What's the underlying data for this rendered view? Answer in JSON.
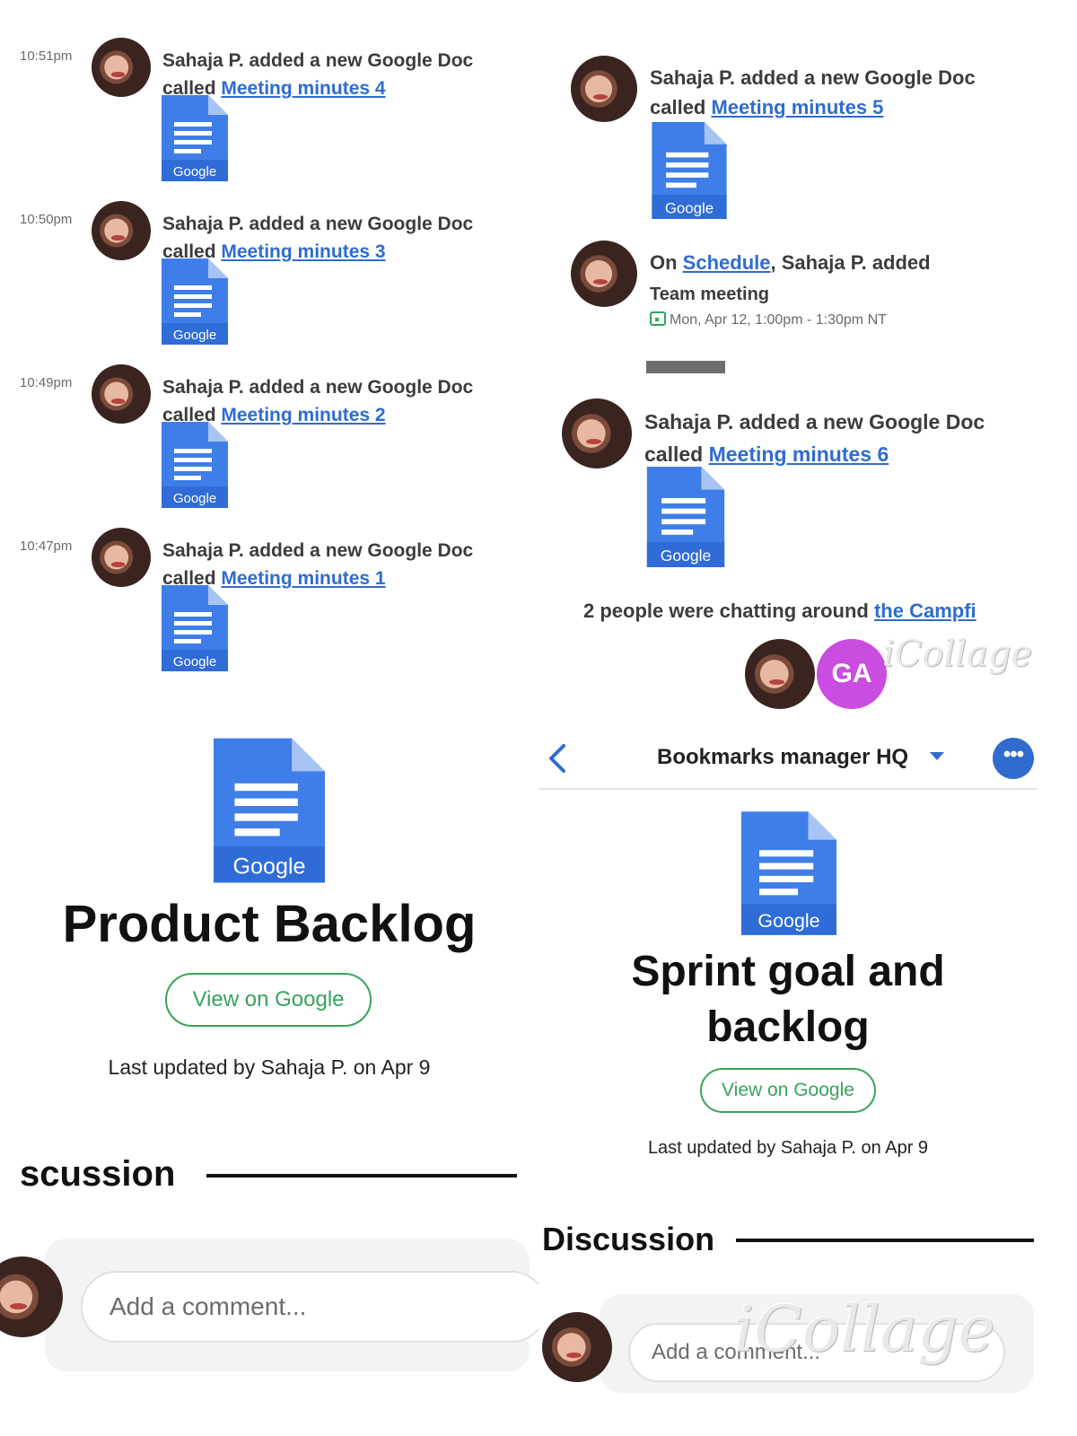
{
  "feed": [
    {
      "time": "10:51pm",
      "prefix": "Sahaja P. added a new Google Doc",
      "called": "called ",
      "link": "Meeting minutes 4",
      "icon_label": "Google"
    },
    {
      "time": "10:50pm",
      "prefix": "Sahaja P. added a new Google Doc",
      "called": "called ",
      "link": "Meeting minutes 3",
      "icon_label": "Google"
    },
    {
      "time": "10:49pm",
      "prefix": "Sahaja P. added a new Google Doc",
      "called": "called ",
      "link": "Meeting minutes 2",
      "icon_label": "Google"
    },
    {
      "time": "10:47pm",
      "prefix": "Sahaja P. added a new Google Doc",
      "called": "called ",
      "link": "Meeting minutes 1",
      "icon_label": "Google"
    }
  ],
  "right_feed": {
    "doc5": {
      "prefix": "Sahaja P. added a new Google Doc",
      "called": "called ",
      "link": "Meeting minutes 5",
      "icon_label": "Google"
    },
    "schedule": {
      "on": "On ",
      "link": "Schedule",
      "rest": ", Sahaja P. added",
      "event": "Team meeting",
      "when": "Mon, Apr 12, 1:00pm - 1:30pm NT"
    },
    "doc6": {
      "prefix": "Sahaja P. added a new Google Doc",
      "called": "called ",
      "link": "Meeting minutes 6",
      "icon_label": "Google"
    },
    "chat": {
      "text": "2 people were chatting around ",
      "link": "the Campfi"
    },
    "badge": "GA"
  },
  "watermark": "iCollage",
  "backlog_page": {
    "icon_label": "Google",
    "title": "Product Backlog",
    "view_button": "View on Google",
    "last_updated": "Last updated by Sahaja P. on Apr 9",
    "section": "scussion",
    "comment_placeholder": "Add a comment..."
  },
  "sprint_page": {
    "nav_title": "Bookmarks manager HQ",
    "more_label": "•••",
    "icon_label": "Google",
    "title_line1": "Sprint goal and",
    "title_line2": "backlog",
    "view_button": "View on Google",
    "last_updated": "Last updated by Sahaja P. on Apr 9",
    "section": "Discussion",
    "comment_placeholder": "Add a comment..."
  },
  "colors": {
    "link": "#2f6cce",
    "doc_blue": "#3f7ee8",
    "doc_fold": "#a8c4f4",
    "button_green": "#38a25c",
    "badge_purple": "#c94de0"
  }
}
